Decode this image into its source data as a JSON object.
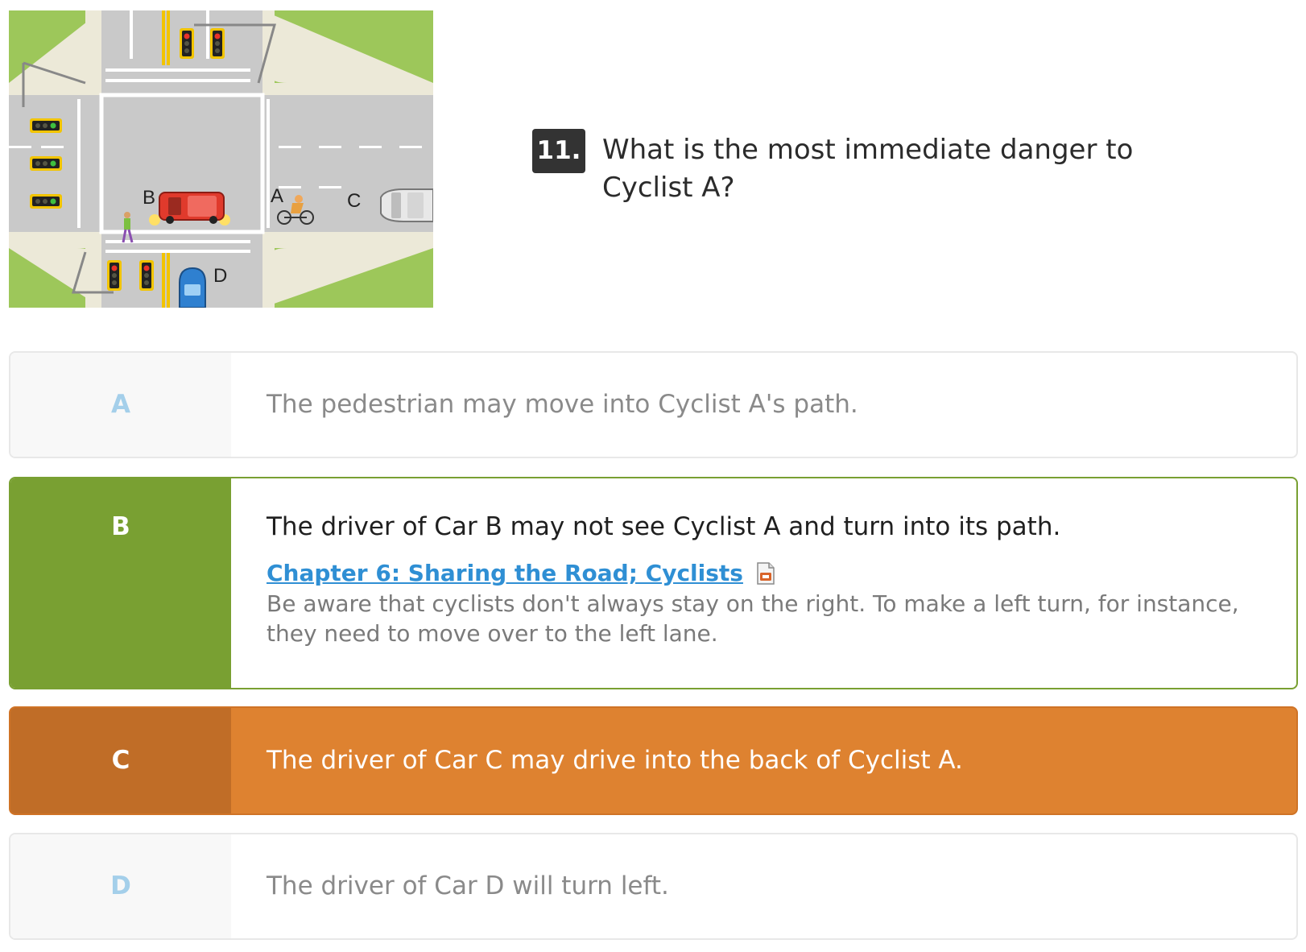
{
  "scene": {
    "labels": [
      "A",
      "B",
      "C",
      "D"
    ]
  },
  "question": {
    "number": "11.",
    "text": "What is the most immediate danger to Cyclist A?"
  },
  "answers": [
    {
      "letter": "A",
      "text": "The pedestrian may move into Cyclist A's path.",
      "state": "neutral"
    },
    {
      "letter": "B",
      "text": "The driver of Car B may not see Cyclist A and turn into its path.",
      "state": "correct",
      "reference": {
        "link": "Chapter 6: Sharing the Road; Cyclists",
        "icon": "document-icon",
        "explanation": "Be aware that cyclists don't always stay on the right. To make a left turn, for instance, they need to move over to the left lane."
      }
    },
    {
      "letter": "C",
      "text": "The driver of Car C may drive into the back of Cyclist A.",
      "state": "selected-wrong"
    },
    {
      "letter": "D",
      "text": "The driver of Car D will turn left.",
      "state": "neutral"
    }
  ],
  "colors": {
    "correct": "#79a032",
    "wrong": "#de8230",
    "wrong_dark": "#c06d27",
    "neutral_letter": "#a4cfea",
    "link": "#2f8fd4"
  }
}
